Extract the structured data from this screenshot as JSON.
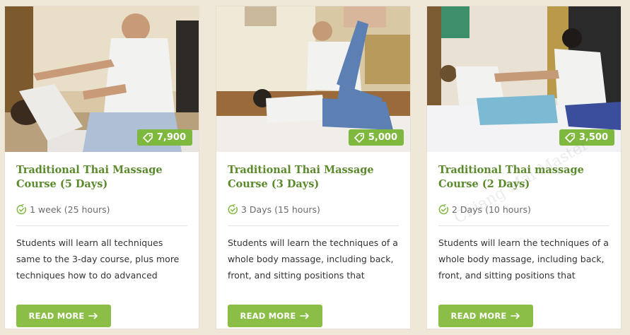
{
  "courses": [
    {
      "price": "7,900",
      "title": "Traditional Thai Massage Course (5 Days)",
      "duration": "1 week (25 hours)",
      "description": "Students will learn all techniques same to the 3-day course, plus more techniques how to do advanced",
      "button_label": "READ MORE"
    },
    {
      "price": "5,000",
      "title": "Traditional Thai Massage Course (3 Days)",
      "duration": "3 Days (15 hours)",
      "description": "Students will learn the techniques of a whole body massage, including back, front, and sitting positions that",
      "button_label": "READ MORE"
    },
    {
      "price": "3,500",
      "title": "Traditional Thai massage Course (2 Days)",
      "duration": "2 Days (10 hours)",
      "description": "Students will learn the techniques of a whole body massage, including back, front, and sitting positions that",
      "button_label": "READ MORE"
    }
  ],
  "watermark": "Chiang Mai Master",
  "colors": {
    "background": "#efe7d8",
    "title_green": "#5a8a2b",
    "button_green": "#8bbe46",
    "badge_green": "#7fb83e"
  },
  "icons": {
    "price": "price-tag-icon",
    "duration": "clock-check-icon",
    "button": "arrow-right-icon"
  }
}
